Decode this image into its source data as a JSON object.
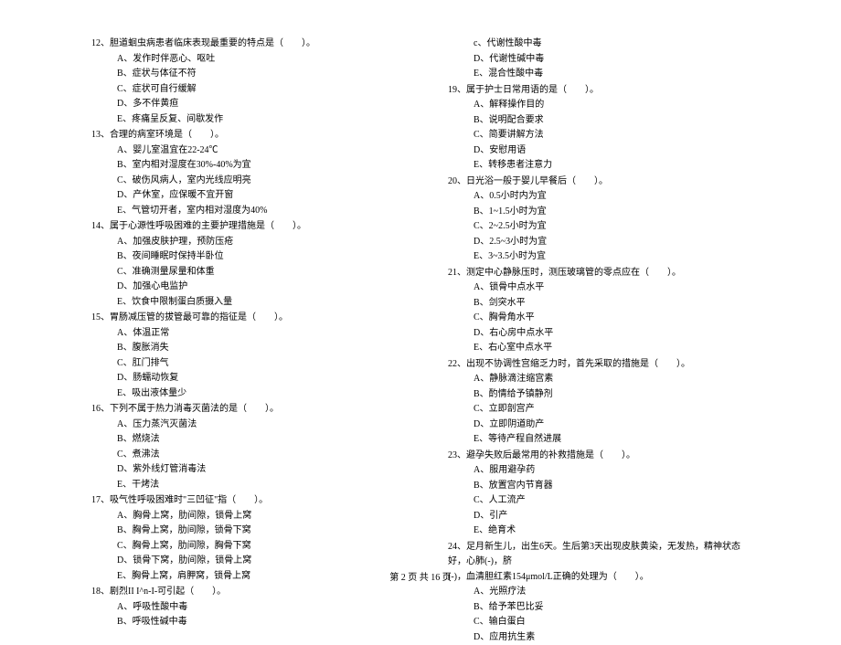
{
  "footer": "第 2 页 共 16 页",
  "left_column": {
    "q12": {
      "stem": "12、胆道蛔虫病患者临床表现最重要的特点是（　　）。",
      "A": "A、发作时伴恶心、呕吐",
      "B": "B、症状与体征不符",
      "C": "C、症状可自行缓解",
      "D": "D、多不伴黄疸",
      "E": "E、疼痛呈反复、间歇发作"
    },
    "q13": {
      "stem": "13、合理的病室环境是（　　）。",
      "A": "A、婴儿室温宜在22-24℃",
      "B": "B、室内相对湿度在30%-40%为宜",
      "C": "C、破伤风病人，室内光线应明亮",
      "D": "D、产休室，应保暖不宜开窗",
      "E": "E、气管切开者，室内相对湿度为40%"
    },
    "q14": {
      "stem": "14、属于心源性呼吸困难的主要护理措施是（　　）。",
      "A": "A、加强皮肤护理，预防压疮",
      "B": "B、夜间睡眠时保持半卧位",
      "C": "C、准确测量尿量和体重",
      "D": "D、加强心电监护",
      "E": "E、饮食中限制蛋白质摄入量"
    },
    "q15": {
      "stem": "15、胃肠减压管的拔管最可靠的指征是（　　）。",
      "A": "A、体温正常",
      "B": "B、腹胀消失",
      "C": "C、肛门排气",
      "D": "D、肠蠕动恢复",
      "E": "E、吸出液体量少"
    },
    "q16": {
      "stem": "16、下列不属于热力消毒灭菌法的是（　　）。",
      "A": "A、压力蒸汽灭菌法",
      "B": "B、燃烧法",
      "C": "C、煮沸法",
      "D": "D、紫外线灯管消毒法",
      "E": "E、干烤法"
    },
    "q17": {
      "stem": "17、吸气性呼吸困难时\"三凹征\"指（　　）。",
      "A": "A、胸骨上窝，肋间隙，锁骨上窝",
      "B": "B、胸骨上窝，肋间隙，锁骨下窝",
      "C": "C、胸骨上窝，肋间隙，胸骨下窝",
      "D": "D、锁骨下窝，肋间隙，锁骨上窝",
      "E": "E、胸骨上窝，肩胛窝，锁骨上窝"
    },
    "q18": {
      "stem": "18、剧烈II I^n-I-可引起（　　）。",
      "A": "A、呼吸性酸中毒",
      "B": "B、呼吸性碱中毒"
    }
  },
  "right_column": {
    "q18_cont": {
      "C": "c、代谢性酸中毒",
      "D": "D、代谢性碱中毒",
      "E": "E、混合性酸中毒"
    },
    "q19": {
      "stem": "19、属于护士日常用语的是（　　）。",
      "A": "A、解释操作目的",
      "B": "B、说明配合要求",
      "C": "C、简要讲解方法",
      "D": "D、安慰用语",
      "E": "E、转移患者注意力"
    },
    "q20": {
      "stem": "20、日光浴一般于婴儿早餐后（　　）。",
      "A": "A、0.5小时内为宜",
      "B": "B、1~1.5小时为宜",
      "C": "C、2~2.5小时为宜",
      "D": "D、2.5~3小时为宜",
      "E": "E、3~3.5小时为宜"
    },
    "q21": {
      "stem": "21、测定中心静脉压时，测压玻璃管的零点应在（　　）。",
      "A": "A、锁骨中点水平",
      "B": "B、剑突水平",
      "C": "C、胸骨角水平",
      "D": "D、右心房中点水平",
      "E": "E、右心室中点水平"
    },
    "q22": {
      "stem": "22、出现不协调性宫缩乏力时，首先采取的措施是（　　）。",
      "A": "A、静脉滴注缩宫素",
      "B": "B、酌情给予镇静剂",
      "C": "C、立即剖宫产",
      "D": "D、立即阴道助产",
      "E": "E、等待产程自然进展"
    },
    "q23": {
      "stem": "23、避孕失败后最常用的补救措施是（　　）。",
      "A": "A、服用避孕药",
      "B": "B、放置宫内节育器",
      "C": "C、人工流产",
      "D": "D、引产",
      "E": "E、绝育术"
    },
    "q24": {
      "stem": "24、足月新生儿，出生6天。生后第3天出现皮肤黄染，无发热，精神状态好，心肺(-)，脐",
      "cont": "(-)，血清胆红素154μmol/L正确的处理为（　　）。",
      "A": "A、光照疗法",
      "B": "B、给予苯巴比妥",
      "C": "C、输白蛋白",
      "D": "D、应用抗生素"
    }
  }
}
